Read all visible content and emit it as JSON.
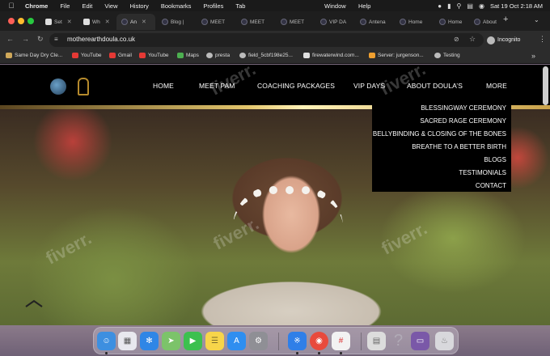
{
  "menubar": {
    "app": "Chrome",
    "items": [
      "File",
      "Edit",
      "View",
      "History",
      "Bookmarks",
      "Profiles",
      "Tab"
    ],
    "window": "Window",
    "help": "Help",
    "clock": "Sat 19 Oct  2:18 AM"
  },
  "tabs": [
    {
      "label": "Set"
    },
    {
      "label": "Wh"
    },
    {
      "label": "An"
    },
    {
      "label": "Blog |"
    },
    {
      "label": "MEET"
    },
    {
      "label": "MEET"
    },
    {
      "label": "MEET"
    },
    {
      "label": "VIP DA"
    },
    {
      "label": "Antena"
    },
    {
      "label": "Home"
    },
    {
      "label": "Home"
    },
    {
      "label": "About"
    }
  ],
  "toolbar": {
    "url": "motherearthdoula.co.uk",
    "profile": "Incognito"
  },
  "bookmarks": [
    {
      "label": "Same Day Dry Cle...",
      "color": "#cfa85a"
    },
    {
      "label": "YouTube",
      "color": "#e53935"
    },
    {
      "label": "Gmail",
      "color": "#e53935"
    },
    {
      "label": "YouTube",
      "color": "#e53935"
    },
    {
      "label": "Maps",
      "color": "#4caf50"
    },
    {
      "label": "presta",
      "color": "#bbbbbb"
    },
    {
      "label": "field_5cbf198e25...",
      "color": "#bbbbbb"
    },
    {
      "label": "firewaterwind.com...",
      "color": "#e0e0e0"
    },
    {
      "label": "Server: jurgenson...",
      "color": "#f0a030"
    },
    {
      "label": "Testing",
      "color": "#bbbbbb"
    }
  ],
  "site": {
    "nav": [
      "HOME",
      "MEET PAM",
      "COACHING PACKAGES",
      "VIP DAYS",
      "ABOUT DOULA’S",
      "MORE"
    ],
    "dropdown": [
      "BLESSINGWAY CEREMONY",
      "SACRED RAGE CEREMONY",
      "BELLYBINDING & CLOSING OF THE BONES",
      "BREATHE TO A BETTER BIRTH",
      "BLOGS",
      "TESTIMONIALS",
      "CONTACT"
    ],
    "watermark": "fiverr."
  },
  "dock": [
    {
      "name": "finder-icon",
      "color": "#3d8fe0"
    },
    {
      "name": "launchpad-icon",
      "color": "#e8e8ee"
    },
    {
      "name": "safari-icon",
      "color": "#2f86e6"
    },
    {
      "name": "maps-icon",
      "color": "#7cc36a"
    },
    {
      "name": "facetime-icon",
      "color": "#3cc04f"
    },
    {
      "name": "notes-icon",
      "color": "#f7d54a"
    },
    {
      "name": "app-store-icon",
      "color": "#2f8ef0"
    },
    {
      "name": "system-settings-icon",
      "color": "#8f8f95"
    },
    {
      "name": "bluetooth-icon",
      "color": "#2f7fe8"
    },
    {
      "name": "chrome-icon",
      "color": "#e84a3c"
    },
    {
      "name": "slack-icon",
      "color": "#f2f2f2"
    },
    {
      "name": "document-icon",
      "color": "#dcdcdc"
    },
    {
      "name": "help-icon",
      "color": "#b0aab6"
    },
    {
      "name": "display-icon",
      "color": "#7a58a8"
    },
    {
      "name": "trash-icon",
      "color": "#d8d8dc"
    }
  ]
}
